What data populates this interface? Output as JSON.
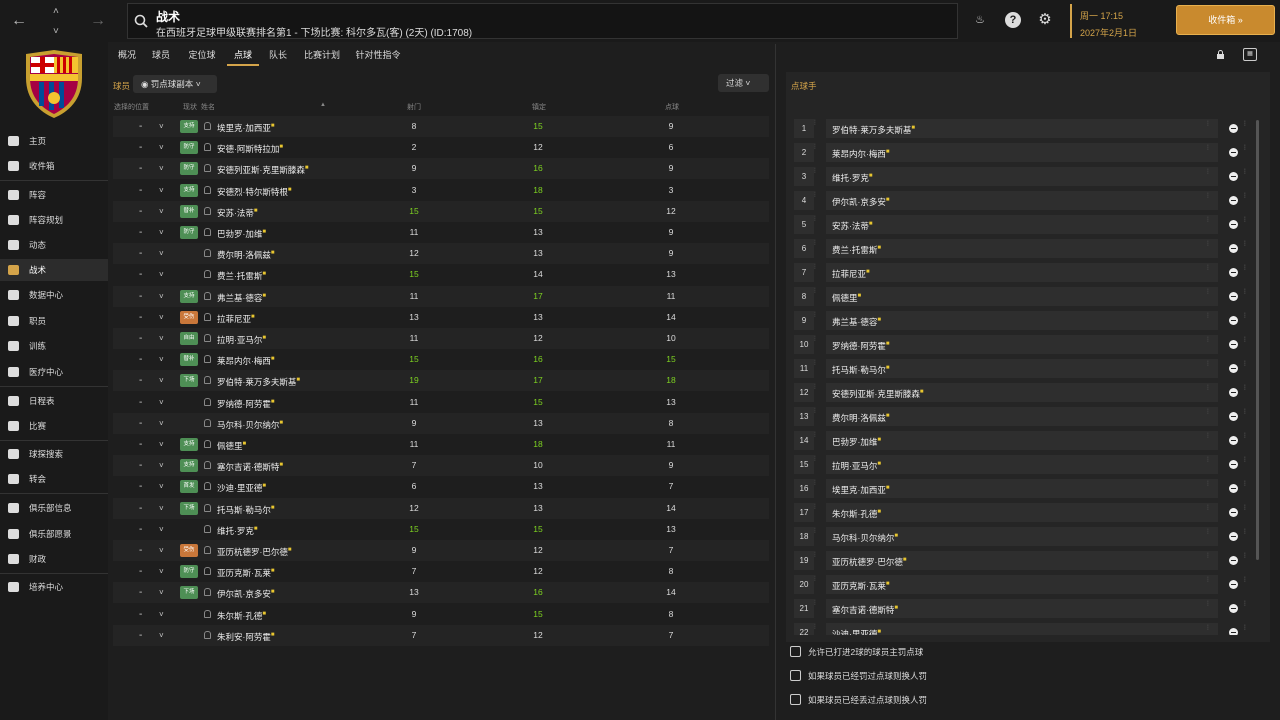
{
  "header": {
    "title": "战术",
    "subtitle": "在西班牙足球甲级联赛排名第1 - 下场比赛: 科尔多瓦(客) (2天) (ID:1708)",
    "date_line1": "周一 17:15",
    "date_line2": "2027年2月1日",
    "inbox_label": "收件箱"
  },
  "sidebar": {
    "items": [
      {
        "label": "主页"
      },
      {
        "label": "收件箱"
      },
      {
        "label": "阵容"
      },
      {
        "label": "阵容规划"
      },
      {
        "label": "动态"
      },
      {
        "label": "战术"
      },
      {
        "label": "数据中心"
      },
      {
        "label": "职员"
      },
      {
        "label": "训练"
      },
      {
        "label": "医疗中心"
      },
      {
        "label": "日程表"
      },
      {
        "label": "比赛"
      },
      {
        "label": "球探搜索"
      },
      {
        "label": "转会"
      },
      {
        "label": "俱乐部信息"
      },
      {
        "label": "俱乐部愿景"
      },
      {
        "label": "财政"
      },
      {
        "label": "培养中心"
      }
    ]
  },
  "tabs": [
    {
      "label": "概况"
    },
    {
      "label": "球员"
    },
    {
      "label": "定位球"
    },
    {
      "label": "点球"
    },
    {
      "label": "队长"
    },
    {
      "label": "比赛计划"
    },
    {
      "label": "针对性指令"
    }
  ],
  "left": {
    "section_label": "球员",
    "view_dropdown": "罚点球副本",
    "filter_label": "过滤",
    "col_position": "选择的位置",
    "col_status": "现状",
    "col_name": "姓名",
    "col_shooting": "射门",
    "col_composure": "镇定",
    "col_penalty": "点球",
    "players": [
      {
        "role": "支持",
        "role_color": "g",
        "name": "埃里克·加西亚",
        "star": true,
        "shoot": "8",
        "comp": "15",
        "pen": "9",
        "hs": false,
        "hc": true,
        "hp": false
      },
      {
        "role": "防守",
        "role_color": "g",
        "name": "安德·阿斯特拉加",
        "star": true,
        "shoot": "2",
        "comp": "12",
        "pen": "6",
        "hs": false,
        "hc": false,
        "hp": false
      },
      {
        "role": "防守",
        "role_color": "g",
        "name": "安德列亚斯·克里斯滕森",
        "star": true,
        "shoot": "9",
        "comp": "16",
        "pen": "9",
        "hs": false,
        "hc": true,
        "hp": false
      },
      {
        "role": "支持",
        "role_color": "g",
        "name": "安德烈·特尔斯特根",
        "star": true,
        "shoot": "3",
        "comp": "18",
        "pen": "3",
        "hs": false,
        "hc": true,
        "hp": false
      },
      {
        "role": "替补",
        "role_color": "g",
        "name": "安苏·法蒂",
        "star": true,
        "shoot": "15",
        "comp": "15",
        "pen": "12",
        "hs": true,
        "hc": true,
        "hp": false
      },
      {
        "role": "防守",
        "role_color": "g",
        "name": "巴勃罗·加维",
        "star": true,
        "shoot": "11",
        "comp": "13",
        "pen": "9",
        "hs": false,
        "hc": false,
        "hp": false
      },
      {
        "role": "",
        "role_color": "",
        "name": "费尔明·洛佩兹",
        "star": true,
        "shoot": "12",
        "comp": "13",
        "pen": "9",
        "hs": false,
        "hc": false,
        "hp": false
      },
      {
        "role": "",
        "role_color": "",
        "name": "费兰·托雷斯",
        "star": true,
        "shoot": "15",
        "comp": "14",
        "pen": "13",
        "hs": true,
        "hc": false,
        "hp": false
      },
      {
        "role": "支持",
        "role_color": "g",
        "name": "弗兰基·德容",
        "star": true,
        "shoot": "11",
        "comp": "17",
        "pen": "11",
        "hs": false,
        "hc": true,
        "hp": false
      },
      {
        "role": "受伤",
        "role_color": "o",
        "name": "拉菲尼亚",
        "star": true,
        "shoot": "13",
        "comp": "13",
        "pen": "14",
        "hs": false,
        "hc": false,
        "hp": false
      },
      {
        "role": "自由",
        "role_color": "g",
        "name": "拉明·亚马尔",
        "star": true,
        "shoot": "11",
        "comp": "12",
        "pen": "10",
        "hs": false,
        "hc": false,
        "hp": false
      },
      {
        "role": "替补",
        "role_color": "g",
        "name": "莱昂内尔·梅西",
        "star": true,
        "shoot": "15",
        "comp": "16",
        "pen": "15",
        "hs": true,
        "hc": true,
        "hp": true
      },
      {
        "role": "下场",
        "role_color": "g",
        "name": "罗伯特·莱万多夫斯基",
        "star": true,
        "shoot": "19",
        "comp": "17",
        "pen": "18",
        "hs": true,
        "hc": true,
        "hp": true
      },
      {
        "role": "",
        "role_color": "",
        "name": "罗纳德·阿劳霍",
        "star": true,
        "shoot": "11",
        "comp": "15",
        "pen": "13",
        "hs": false,
        "hc": true,
        "hp": false
      },
      {
        "role": "",
        "role_color": "",
        "name": "马尔科·贝尔纳尔",
        "star": true,
        "shoot": "9",
        "comp": "13",
        "pen": "8",
        "hs": false,
        "hc": false,
        "hp": false
      },
      {
        "role": "支持",
        "role_color": "g",
        "name": "佩德里",
        "star": true,
        "shoot": "11",
        "comp": "18",
        "pen": "11",
        "hs": false,
        "hc": true,
        "hp": false
      },
      {
        "role": "支持",
        "role_color": "g",
        "name": "塞尔吉诺·德斯特",
        "star": true,
        "shoot": "7",
        "comp": "10",
        "pen": "9",
        "hs": false,
        "hc": false,
        "hp": false
      },
      {
        "role": "首发",
        "role_color": "g",
        "name": "沙迪·里亚德",
        "star": true,
        "shoot": "6",
        "comp": "13",
        "pen": "7",
        "hs": false,
        "hc": false,
        "hp": false
      },
      {
        "role": "下场",
        "role_color": "g",
        "name": "托马斯·勒马尔",
        "star": true,
        "shoot": "12",
        "comp": "13",
        "pen": "14",
        "hs": false,
        "hc": false,
        "hp": false
      },
      {
        "role": "",
        "role_color": "",
        "name": "维托·罗克",
        "star": true,
        "shoot": "15",
        "comp": "15",
        "pen": "13",
        "hs": true,
        "hc": true,
        "hp": false
      },
      {
        "role": "受伤",
        "role_color": "o",
        "name": "亚历杭德罗·巴尔德",
        "star": true,
        "shoot": "9",
        "comp": "12",
        "pen": "7",
        "hs": false,
        "hc": false,
        "hp": false
      },
      {
        "role": "防守",
        "role_color": "g",
        "name": "亚历克斯·瓦莱",
        "star": true,
        "shoot": "7",
        "comp": "12",
        "pen": "8",
        "hs": false,
        "hc": false,
        "hp": false
      },
      {
        "role": "下场",
        "role_color": "g",
        "name": "伊尔凯·京多安",
        "star": true,
        "shoot": "13",
        "comp": "16",
        "pen": "14",
        "hs": false,
        "hc": true,
        "hp": false
      },
      {
        "role": "",
        "role_color": "",
        "name": "朱尔斯·孔德",
        "star": true,
        "shoot": "9",
        "comp": "15",
        "pen": "8",
        "hs": false,
        "hc": true,
        "hp": false
      },
      {
        "role": "",
        "role_color": "",
        "name": "朱利安·阿劳霍",
        "star": true,
        "shoot": "7",
        "comp": "12",
        "pen": "7",
        "hs": false,
        "hc": false,
        "hp": false
      }
    ]
  },
  "right": {
    "title": "点球手",
    "takers": [
      {
        "no": "1",
        "name": "罗伯特·莱万多夫斯基"
      },
      {
        "no": "2",
        "name": "莱昂内尔·梅西"
      },
      {
        "no": "3",
        "name": "维托·罗克"
      },
      {
        "no": "4",
        "name": "伊尔凯·京多安"
      },
      {
        "no": "5",
        "name": "安苏·法蒂"
      },
      {
        "no": "6",
        "name": "费兰·托雷斯"
      },
      {
        "no": "7",
        "name": "拉菲尼亚"
      },
      {
        "no": "8",
        "name": "佩德里"
      },
      {
        "no": "9",
        "name": "弗兰基·德容"
      },
      {
        "no": "10",
        "name": "罗纳德·阿劳霍"
      },
      {
        "no": "11",
        "name": "托马斯·勒马尔"
      },
      {
        "no": "12",
        "name": "安德列亚斯·克里斯滕森"
      },
      {
        "no": "13",
        "name": "费尔明·洛佩兹"
      },
      {
        "no": "14",
        "name": "巴勃罗·加维"
      },
      {
        "no": "15",
        "name": "拉明·亚马尔"
      },
      {
        "no": "16",
        "name": "埃里克·加西亚"
      },
      {
        "no": "17",
        "name": "朱尔斯·孔德"
      },
      {
        "no": "18",
        "name": "马尔科·贝尔纳尔"
      },
      {
        "no": "19",
        "name": "亚历杭德罗·巴尔德"
      },
      {
        "no": "20",
        "name": "亚历克斯·瓦莱"
      },
      {
        "no": "21",
        "name": "塞尔吉诺·德斯特"
      },
      {
        "no": "22",
        "name": "沙迪·里亚德"
      }
    ],
    "options": [
      {
        "label": "允许已打进2球的球员主罚点球"
      },
      {
        "label": "如果球员已经罚过点球则换人罚"
      },
      {
        "label": "如果球员已经丢过点球则换人罚"
      }
    ]
  }
}
